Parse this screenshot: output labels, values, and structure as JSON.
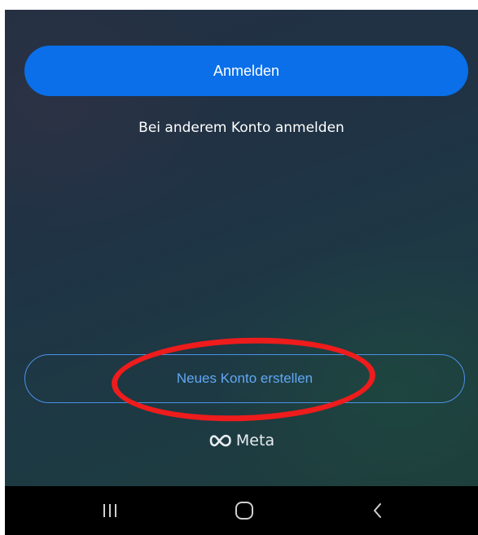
{
  "login": {
    "primary_button_label": "Anmelden",
    "other_account_link": "Bei anderem Konto anmelden",
    "create_account_button_label": "Neues Konto erstellen",
    "brand_label": "Meta"
  },
  "annotation": {
    "highlight": "red-ellipse-around-create-account"
  },
  "nav_bar": {
    "items": [
      {
        "name": "recent-apps",
        "icon": "recents-icon"
      },
      {
        "name": "home",
        "icon": "home-icon"
      },
      {
        "name": "back",
        "icon": "back-icon"
      }
    ]
  },
  "colors": {
    "primary_button": "#0a6fe8",
    "outline_button_border": "#4b90e6",
    "outline_button_text": "#62a7f5",
    "highlight": "#ee1c1c",
    "nav_bar": "#000000"
  }
}
